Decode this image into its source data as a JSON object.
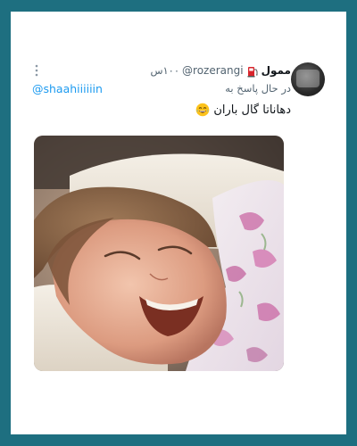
{
  "tweet": {
    "display_name": "ممول",
    "handle": "@rozerangi",
    "time": "۱۰۰س",
    "reply_prefix": "در حال پاسخ به",
    "reply_handle": "@shaahiiiiiin",
    "text": "دهاناتا گال باران",
    "icons": {
      "badge": "fuel-pump-icon",
      "emoji": "laughing-face-icon",
      "more": "more-vertical-icon"
    },
    "media": {
      "kind": "photo"
    }
  },
  "colors": {
    "background": "#1e6f80",
    "card": "#ffffff",
    "link": "#1d9bf0",
    "secondary_text": "#536471",
    "primary_text": "#0f1419"
  }
}
